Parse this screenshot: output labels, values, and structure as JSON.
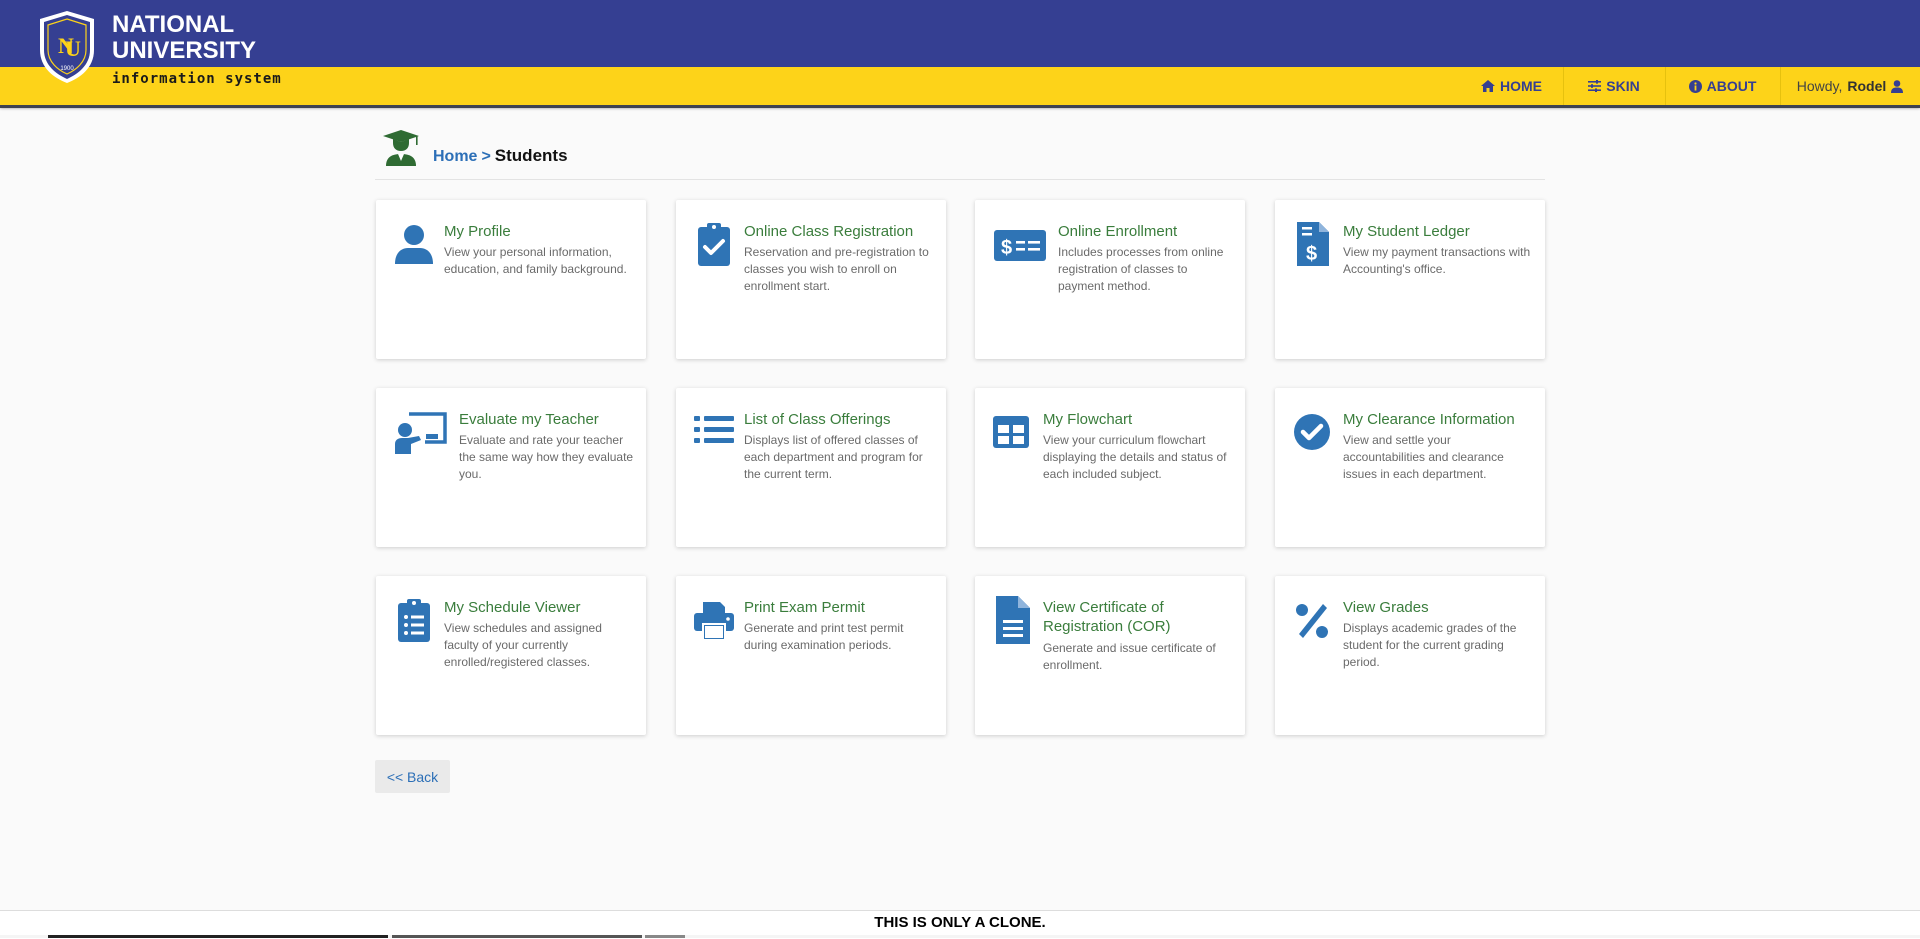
{
  "header": {
    "brand_line1": "NATIONAL",
    "brand_line2": "UNIVERSITY",
    "brand_sub": "information system",
    "logo_year": "1900",
    "colors": {
      "primary": "#353f92",
      "accent": "#fdd319",
      "title_green": "#3a7d3c",
      "link_blue": "#2c6fb7",
      "icon_blue": "#2f74b5"
    }
  },
  "nav": {
    "home": "HOME",
    "skin": "SKIN",
    "about": "ABOUT",
    "howdy": "Howdy,",
    "user": "Rodel"
  },
  "breadcrumb": {
    "home": "Home",
    "separator": ">",
    "current": "Students"
  },
  "cards": [
    {
      "icon": "user-icon",
      "title": "My Profile",
      "desc": "View your personal information, education, and family background."
    },
    {
      "icon": "clipboard-check-icon",
      "title": "Online Class Registration",
      "desc": "Reservation and pre-registration to classes you wish to enroll on enrollment start."
    },
    {
      "icon": "money-check-icon",
      "title": "Online Enrollment",
      "desc": "Includes processes from online registration of classes to payment method."
    },
    {
      "icon": "invoice-dollar-icon",
      "title": "My Student Ledger",
      "desc": "View my payment transactions with Accounting's office."
    },
    {
      "icon": "chalkboard-teacher-icon",
      "title": "Evaluate my Teacher",
      "desc": "Evaluate and rate your teacher the same way how they evaluate you."
    },
    {
      "icon": "list-icon",
      "title": "List of Class Offerings",
      "desc": "Displays list of offered classes of each department and program for the current term."
    },
    {
      "icon": "table-grid-icon",
      "title": "My Flowchart",
      "desc": "View your curriculum flowchart displaying the details and status of each included subject."
    },
    {
      "icon": "check-circle-icon",
      "title": "My Clearance Information",
      "desc": "View and settle your accountabilities and clearance issues in each department."
    },
    {
      "icon": "clipboard-list-icon",
      "title": "My Schedule Viewer",
      "desc": "View schedules and assigned faculty of your currently enrolled/registered classes."
    },
    {
      "icon": "print-icon",
      "title": "Print Exam Permit",
      "desc": "Generate and print test permit during examination periods."
    },
    {
      "icon": "file-alt-icon",
      "title": "View Certificate of Registration (COR)",
      "desc": "Generate and issue certificate of enrollment."
    },
    {
      "icon": "percent-icon",
      "title": "View Grades",
      "desc": "Displays academic grades of the student for the current grading period."
    }
  ],
  "back_label": "<< Back",
  "footer_text": "THIS IS ONLY A CLONE."
}
